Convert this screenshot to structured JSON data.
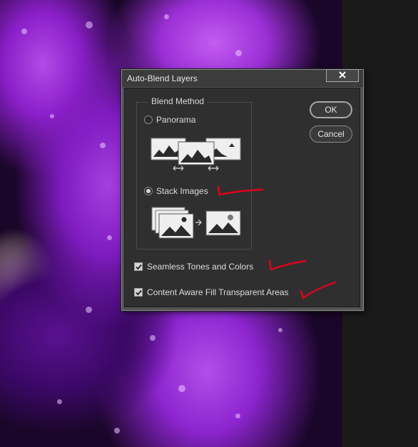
{
  "dialog": {
    "title": "Auto-Blend Layers",
    "close_icon": "close-icon",
    "group_title": "Blend Method",
    "options": [
      {
        "label": "Panorama",
        "selected": false
      },
      {
        "label": "Stack Images",
        "selected": true
      }
    ],
    "checkboxes": [
      {
        "label": "Seamless Tones and Colors",
        "checked": true
      },
      {
        "label": "Content Aware Fill Transparent Areas",
        "checked": true
      }
    ],
    "ok_label": "OK",
    "cancel_label": "Cancel"
  },
  "annotations": {
    "color": "#e0001a",
    "count": 3
  },
  "colors": {
    "dialog_bg": "#2f2f2f",
    "title_bar": "#3c3c3c",
    "text": "#dcdcdc",
    "photo_accent": "#9a2fd6"
  }
}
